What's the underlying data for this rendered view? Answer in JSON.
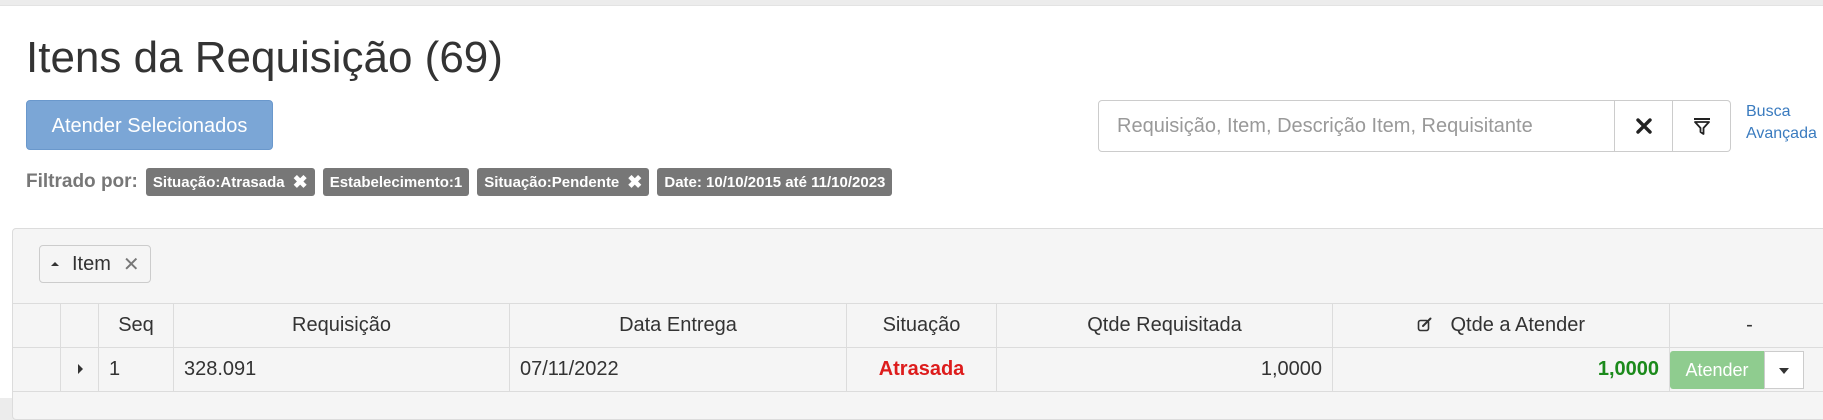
{
  "page": {
    "title": "Itens da Requisição (69)",
    "primary_button": "Atender Selecionados"
  },
  "search": {
    "placeholder": "Requisição, Item, Descrição Item, Requisitante",
    "advanced_line1": "Busca",
    "advanced_line2": "Avançada"
  },
  "filters": {
    "label": "Filtrado por:",
    "chips": [
      {
        "text": "Situação:Atrasada",
        "closable": true
      },
      {
        "text": "Estabelecimento:1",
        "closable": false
      },
      {
        "text": "Situação:Pendente",
        "closable": true
      },
      {
        "text": "Date: 10/10/2015 até 11/10/2023",
        "closable": false
      }
    ]
  },
  "grouping": {
    "label": "Item"
  },
  "table": {
    "headers": [
      "Seq",
      "Requisição",
      "Data Entrega",
      "Situação",
      "Qtde Requisitada",
      "Qtde a Atender",
      "-"
    ],
    "rows": [
      {
        "seq": "1",
        "requisicao": "328.091",
        "data_entrega": "07/11/2022",
        "situacao": "Atrasada",
        "qtde_requisitada": "1,0000",
        "qtde_atender": "1,0000",
        "action": "Atender"
      }
    ]
  },
  "colors": {
    "primary": "#7ba6d6",
    "chip": "#777777",
    "status_late": "#dd1c1c",
    "qty_green": "#1b8a1b",
    "atender": "#8fcc8f"
  }
}
